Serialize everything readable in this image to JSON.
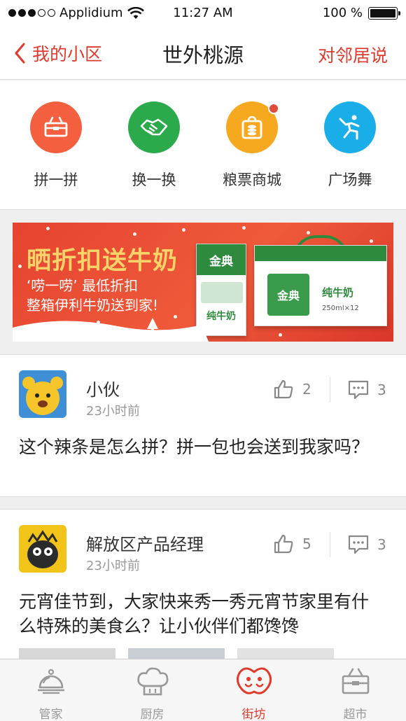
{
  "status_bar": {
    "carrier": "Applidium",
    "time": "11:27 AM",
    "battery": "100 %"
  },
  "nav": {
    "back_label": "我的小区",
    "title": "世外桃源",
    "right_label": "对邻居说"
  },
  "quick_menu": [
    {
      "label": "拼一拼",
      "icon": "basket-icon",
      "color": "#f4603f"
    },
    {
      "label": "换一换",
      "icon": "handshake-icon",
      "color": "#2aaa4a"
    },
    {
      "label": "粮票商城",
      "icon": "shopping-bag-icon",
      "color": "#f6a81f"
    },
    {
      "label": "广场舞",
      "icon": "dancer-icon",
      "color": "#1aaee9"
    }
  ],
  "banner": {
    "title": "晒折扣送牛奶",
    "line1": "‘唠一唠’ 最低折扣",
    "line2": "整箱伊利牛奶送到家!",
    "product_brand": "金典",
    "product_name": "纯牛奶",
    "product_sub": "250ml×12"
  },
  "posts": [
    {
      "username": "小伙",
      "time": "23小时前",
      "likes": "2",
      "comments": "3",
      "content": "这个辣条是怎么拼？拼一包也会送到我家吗？"
    },
    {
      "username": "解放区产品经理",
      "time": "23小时前",
      "likes": "5",
      "comments": "3",
      "content": "元宵佳节到，大家快来秀一秀元宵节家里有什么特殊的美食么？让小伙伴们都馋馋"
    }
  ],
  "tabs": [
    {
      "label": "管家",
      "icon": "butler-bell-icon",
      "active": false
    },
    {
      "label": "厨房",
      "icon": "chef-hat-icon",
      "active": false
    },
    {
      "label": "街坊",
      "icon": "neighbors-icon",
      "active": true
    },
    {
      "label": "超市",
      "icon": "shopping-basket-icon",
      "active": false
    }
  ],
  "colors": {
    "accent": "#e03a2c",
    "inactive": "#999999"
  }
}
